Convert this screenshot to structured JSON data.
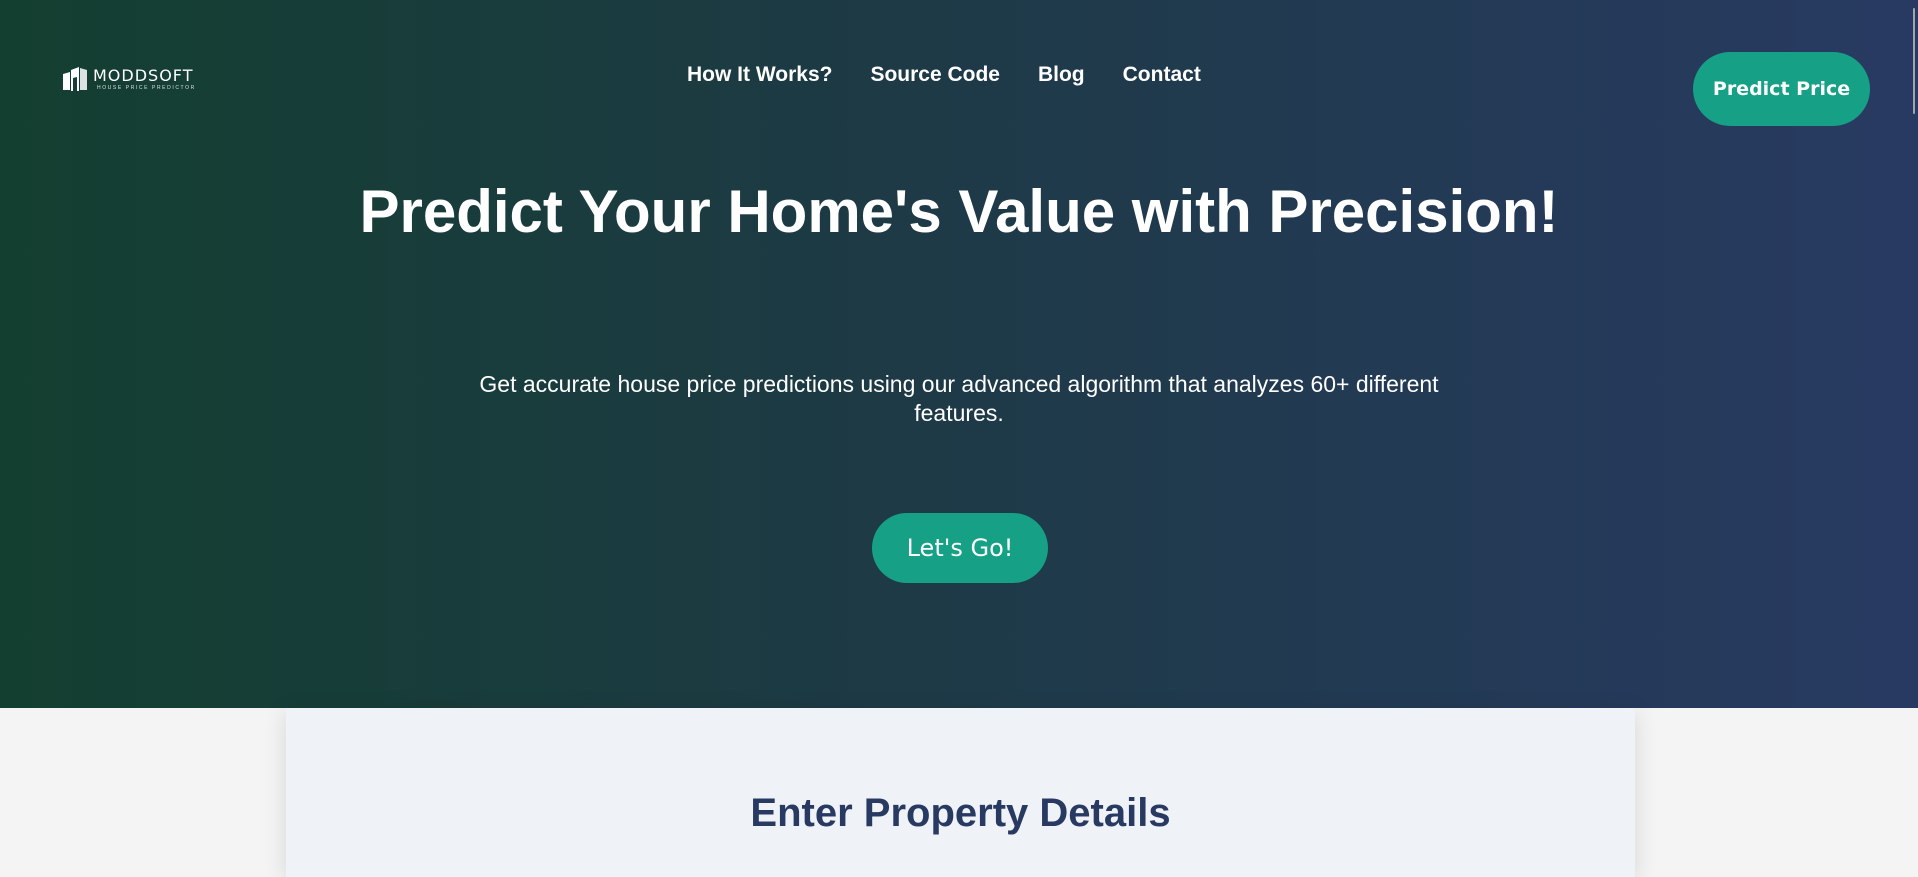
{
  "brand": {
    "name": "MODDSOFT",
    "tagline": "HOUSE PRICE PREDICTOR",
    "logo_icon": "building-logo-icon"
  },
  "nav": {
    "items": [
      {
        "label": "How It Works?"
      },
      {
        "label": "Source Code"
      },
      {
        "label": "Blog"
      },
      {
        "label": "Contact"
      }
    ]
  },
  "header": {
    "cta_label": "Predict Price"
  },
  "hero": {
    "title": "Predict Your Home's Value with Precision!",
    "subtitle": "Get accurate house price predictions using our advanced algorithm that analyzes 60+ different features.",
    "button_label": "Let's Go!"
  },
  "form_section": {
    "title": "Enter Property Details"
  },
  "colors": {
    "hero_gradient_start": "#133f30",
    "hero_gradient_end": "#283a62",
    "accent": "#16a086",
    "heading": "#283a62",
    "card_bg": "#eff2f7"
  }
}
